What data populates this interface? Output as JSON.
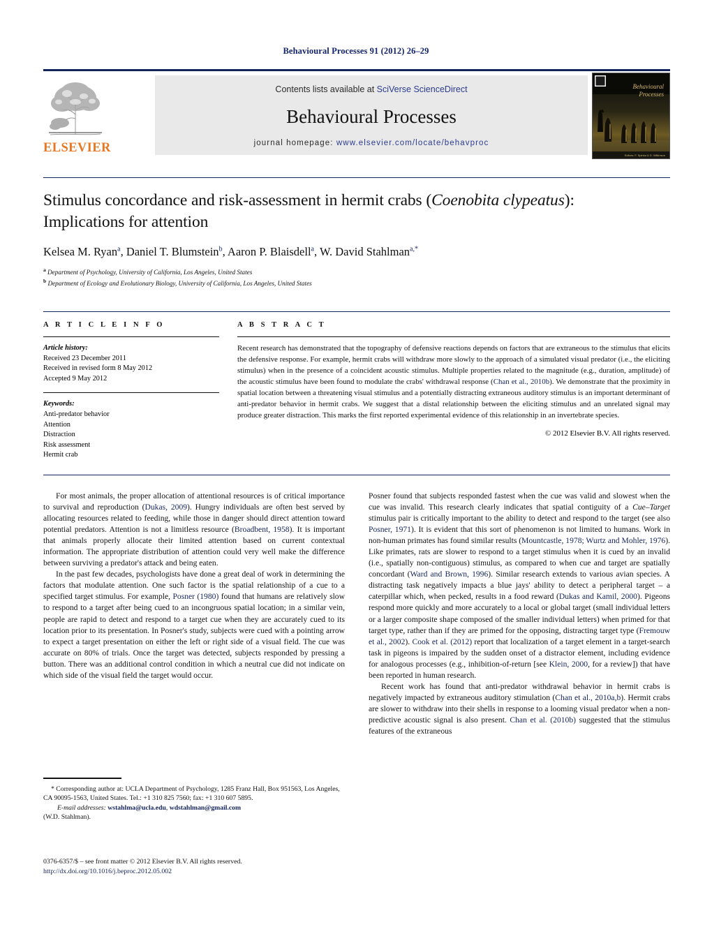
{
  "running_head": "Behavioural Processes 91 (2012) 26–29",
  "masthead": {
    "publisher_name": "ELSEVIER",
    "contents_prefix": "Contents lists available at ",
    "contents_link": "SciVerse ScienceDirect",
    "journal_title": "Behavioural Processes",
    "homepage_label": "journal homepage: ",
    "homepage_url": "www.elsevier.com/locate/behavproc",
    "cover_title_line1": "Behavioural",
    "cover_title_line2": "Processes",
    "cover_editors": "Editors: F. Spinka & D. Wilkinson"
  },
  "title": {
    "line1_a": "Stimulus concordance and risk-assessment in hermit crabs (",
    "line1_italic": "Coenobita clypeatus",
    "line1_b": "):",
    "line2": "Implications for attention"
  },
  "authors": {
    "a1": "Kelsea M. Ryan",
    "s1": "a",
    "a2": "Daniel T. Blumstein",
    "s2": "b",
    "a3": "Aaron P. Blaisdell",
    "s3": "a",
    "a4": "W. David Stahlman",
    "s4": "a,*"
  },
  "affiliations": [
    {
      "marker": "a",
      "text": "Department of Psychology, University of California, Los Angeles, United States"
    },
    {
      "marker": "b",
      "text": "Department of Ecology and Evolutionary Biology, University of California, Los Angeles, United States"
    }
  ],
  "article_info": {
    "heading": "A R T I C L E  I N F O",
    "history_label": "Article history:",
    "history": [
      "Received 23 December 2011",
      "Received in revised form 8 May 2012",
      "Accepted 9 May 2012"
    ],
    "keywords_label": "Keywords:",
    "keywords": [
      "Anti-predator behavior",
      "Attention",
      "Distraction",
      "Risk assessment",
      "Hermit crab"
    ]
  },
  "abstract": {
    "heading": "A B S T R A C T",
    "p1_a": "Recent research has demonstrated that the topography of defensive reactions depends on factors that are extraneous to the stimulus that elicits the defensive response. For example, hermit crabs will withdraw more slowly to the approach of a simulated visual predator (i.e., the eliciting stimulus) when in the presence of a coincident acoustic stimulus. Multiple properties related to the magnitude (e.g., duration, amplitude) of the acoustic stimulus have been found to modulate the crabs' withdrawal response (",
    "p1_ref": "Chan et al., 2010b",
    "p1_b": "). We demonstrate that the proximity in spatial location between a threatening visual stimulus and a potentially distracting extraneous auditory stimulus is an important determinant of anti-predator behavior in hermit crabs. We suggest that a distal relationship between the eliciting stimulus and an unrelated signal may produce greater distraction. This marks the first reported experimental evidence of this relationship in an invertebrate species.",
    "copyright": "© 2012 Elsevier B.V. All rights reserved."
  },
  "body": {
    "left": {
      "p1_a": "For most animals, the proper allocation of attentional resources is of critical importance to survival and reproduction (",
      "p1_r1": "Dukas, 2009",
      "p1_b": "). Hungry individuals are often best served by allocating resources related to feeding, while those in danger should direct attention toward potential predators. Attention is not a limitless resource (",
      "p1_r2": "Broadbent, 1958",
      "p1_c": "). It is important that animals properly allocate their limited attention based on current contextual information. The appropriate distribution of attention could very well make the difference between surviving a predator's attack and being eaten.",
      "p2_a": "In the past few decades, psychologists have done a great deal of work in determining the factors that modulate attention. One such factor is the spatial relationship of a cue to a specified target stimulus. For example, ",
      "p2_r1": "Posner (1980)",
      "p2_b": " found that humans are relatively slow to respond to a target after being cued to an incongruous spatial location; in a similar vein, people are rapid to detect and respond to a target cue when they are accurately cued to its location prior to its presentation. In Posner's study, subjects were cued with a pointing arrow to expect a target presentation on either the left or right side of a visual field. The cue was accurate on 80% of trials. Once the target was detected, subjects responded by pressing a button. There was an additional control condition in which a neutral cue did not indicate on which side of the visual field the target would occur."
    },
    "right": {
      "p1_a": "Posner found that subjects responded fastest when the cue was valid and slowest when the cue was invalid. This research clearly indicates that spatial contiguity of a ",
      "p1_i1": "Cue–Target",
      "p1_b": " stimulus pair is critically important to the ability to detect and respond to the target (see also ",
      "p1_r1": "Posner, 1971",
      "p1_c": "). It is evident that this sort of phenomenon is not limited to humans. Work in non-human primates has found similar results (",
      "p1_r2": "Mountcastle, 1978; Wurtz and Mohler, 1976",
      "p1_d": "). Like primates, rats are slower to respond to a target stimulus when it is cued by an invalid (i.e., spatially non-contiguous) stimulus, as compared to when cue and target are spatially concordant (",
      "p1_r3": "Ward and Brown, 1996",
      "p1_e": "). Similar research extends to various avian species. A distracting task negatively impacts a blue jays' ability to detect a peripheral target – a caterpillar which, when pecked, results in a food reward (",
      "p1_r4": "Dukas and Kamil, 2000",
      "p1_f": "). Pigeons respond more quickly and more accurately to a local or global target (small individual letters or a larger composite shape composed of the smaller individual letters) when primed for that target type, rather than if they are primed for the opposing, distracting target type (",
      "p1_r5": "Fremouw et al., 2002",
      "p1_g": "). ",
      "p1_r6": "Cook et al. (2012)",
      "p1_h": " report that localization of a target element in a target-search task in pigeons is impaired by the sudden onset of a distractor element, including evidence for analogous processes (e.g., inhibition-of-return [see ",
      "p1_r7": "Klein, 2000",
      "p1_i": ", for a review]) that have been reported in human research.",
      "p2_a": "Recent work has found that anti-predator withdrawal behavior in hermit crabs is negatively impacted by extraneous auditory stimulation (",
      "p2_r1": "Chan et al., 2010a,b",
      "p2_b": "). Hermit crabs are slower to withdraw into their shells in response to a looming visual predator when a non-predictive acoustic signal is also present. ",
      "p2_r2": "Chan et al. (2010b)",
      "p2_c": " suggested that the stimulus features of the extraneous"
    }
  },
  "footnote": {
    "star_a": "* Corresponding author at: UCLA Department of Psychology, 1285 Franz Hall, Box 951563, Los Angeles, CA 90095-1563, United States. Tel.: +1 310 825 7560; fax: +1 310 607 5895.",
    "email_label": "E-mail addresses:",
    "email1": "wstahlma@ucla.edu",
    "email_sep": ", ",
    "email2": "wdstahlman@gmail.com",
    "email_owner": "(W.D. Stahlman)."
  },
  "imprint": {
    "line1": "0376-6357/$ – see front matter © 2012 Elsevier B.V. All rights reserved.",
    "doi": "http://dx.doi.org/10.1016/j.beproc.2012.05.002"
  }
}
